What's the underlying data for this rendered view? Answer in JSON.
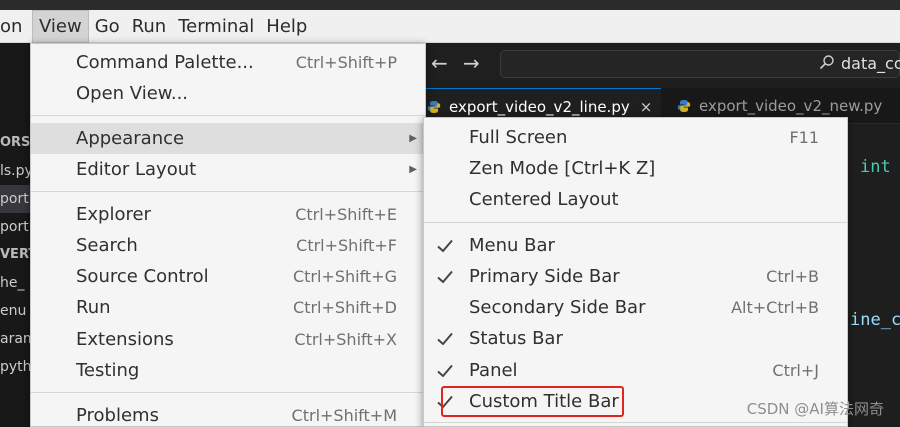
{
  "menubar": {
    "items": [
      "on",
      "View",
      "Go",
      "Run",
      "Terminal",
      "Help"
    ]
  },
  "sidebar": {
    "rows": [
      "ORS",
      "ls.py",
      "port",
      "port",
      "VERT",
      "he_",
      "enu",
      "aram",
      "pyth"
    ]
  },
  "nav": {
    "back_icon": "arrow-left-icon",
    "forward_icon": "arrow-right-icon",
    "search_text": "data_co"
  },
  "tabs": [
    {
      "label": "export_video_v2_line.py",
      "close": "×"
    },
    {
      "label": "export_video_v2_new.py"
    }
  ],
  "code": {
    "keyword": "int",
    "fragment": "ine_c"
  },
  "view_menu": {
    "items": [
      {
        "label": "Command Palette...",
        "shortcut": "Ctrl+Shift+P"
      },
      {
        "label": "Open View...",
        "shortcut": ""
      },
      {
        "label": "Appearance",
        "shortcut": "",
        "submenu": "▶"
      },
      {
        "label": "Editor Layout",
        "shortcut": "",
        "submenu": "▶"
      },
      {
        "label": "Explorer",
        "shortcut": "Ctrl+Shift+E"
      },
      {
        "label": "Search",
        "shortcut": "Ctrl+Shift+F"
      },
      {
        "label": "Source Control",
        "shortcut": "Ctrl+Shift+G"
      },
      {
        "label": "Run",
        "shortcut": "Ctrl+Shift+D"
      },
      {
        "label": "Extensions",
        "shortcut": "Ctrl+Shift+X"
      },
      {
        "label": "Testing",
        "shortcut": ""
      },
      {
        "label": "Problems",
        "shortcut": "Ctrl+Shift+M"
      }
    ]
  },
  "appearance_menu": {
    "items": [
      {
        "label": "Full Screen",
        "shortcut": "F11",
        "checked": false
      },
      {
        "label": "Zen Mode [Ctrl+K Z]",
        "shortcut": "",
        "checked": false
      },
      {
        "label": "Centered Layout",
        "shortcut": "",
        "checked": false
      },
      {
        "label": "Menu Bar",
        "shortcut": "",
        "checked": true
      },
      {
        "label": "Primary Side Bar",
        "shortcut": "Ctrl+B",
        "checked": true
      },
      {
        "label": "Secondary Side Bar",
        "shortcut": "Alt+Ctrl+B",
        "checked": false
      },
      {
        "label": "Status Bar",
        "shortcut": "",
        "checked": true
      },
      {
        "label": "Panel",
        "shortcut": "Ctrl+J",
        "checked": true
      },
      {
        "label": "Custom Title Bar",
        "shortcut": "",
        "checked": true
      }
    ]
  },
  "watermark": "CSDN @AI算法网奇",
  "colors": {
    "highlight_box": "#e0241f",
    "accent": "#0078d4"
  }
}
